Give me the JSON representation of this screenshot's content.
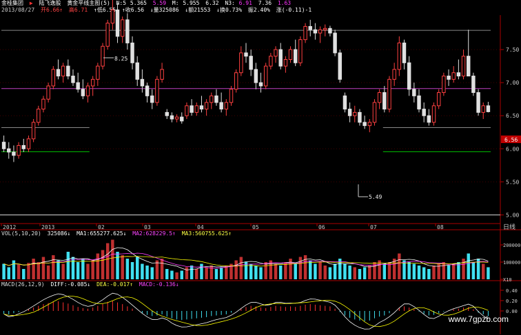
{
  "toolbar": {
    "stock": "金桂集团",
    "name": "陆飞逸股",
    "indicator": "黄金平线主图(5)",
    "n": "N:5",
    "v1": "5.365",
    "v2": "5.59",
    "m": "M:",
    "v3": "5.955",
    "v4": "6.32",
    "n3": "N3:",
    "v5": "6.91",
    "v6": "7.36",
    "v7": "1.63"
  },
  "quote": {
    "date": "2013/08/27",
    "open": "开6.66↑",
    "high": "高6.71",
    "low": "↑低6.55",
    "close": "↑收6.56",
    "vol": "↓量325086",
    "amount": "↓额21553",
    "turnover": "↓换0.73%",
    "amp": "振2.40%",
    "chg": "涨(-0.11)-1"
  },
  "chart_data": {
    "type": "candlestick",
    "colors": {
      "up": "#ff4040",
      "down": "#e0e0e0",
      "ma1": "#ffffff",
      "ma2": "#ff40ff",
      "ma3": "#ffff00",
      "hline": "#c040c0",
      "green": "#00c000"
    },
    "price_axis": {
      "min": 4.9,
      "max": 8.0,
      "ticks": [
        "5.00",
        "5.50",
        "6.00",
        "6.50",
        "7.00",
        "7.50"
      ]
    },
    "current_price": "6.56",
    "max_label": "8.25",
    "min_label": "5.49",
    "x_labels": [
      "2012",
      "2013",
      "02",
      "03",
      "04",
      "05",
      "06",
      "07",
      "08"
    ],
    "period_button": "日线",
    "candles": [
      [
        6.1,
        6.2,
        5.95,
        6.0
      ],
      [
        6.0,
        6.1,
        5.85,
        5.95
      ],
      [
        5.95,
        6.05,
        5.8,
        5.9
      ],
      [
        5.9,
        6.1,
        5.85,
        6.05
      ],
      [
        6.05,
        6.15,
        5.95,
        6.0
      ],
      [
        6.0,
        6.2,
        5.95,
        6.15
      ],
      [
        6.15,
        6.45,
        6.1,
        6.4
      ],
      [
        6.4,
        6.65,
        6.35,
        6.6
      ],
      [
        6.6,
        6.8,
        6.55,
        6.75
      ],
      [
        6.75,
        7.0,
        6.7,
        6.95
      ],
      [
        6.95,
        7.25,
        6.9,
        7.2
      ],
      [
        7.2,
        7.35,
        7.05,
        7.1
      ],
      [
        7.1,
        7.3,
        7.0,
        7.25
      ],
      [
        7.25,
        7.35,
        7.05,
        7.1
      ],
      [
        7.1,
        7.2,
        6.95,
        7.0
      ],
      [
        7.0,
        7.15,
        6.85,
        6.9
      ],
      [
        6.9,
        7.05,
        6.75,
        6.8
      ],
      [
        6.8,
        7.0,
        6.7,
        6.95
      ],
      [
        6.95,
        7.1,
        6.8,
        7.05
      ],
      [
        7.05,
        7.3,
        6.95,
        7.25
      ],
      [
        7.25,
        7.6,
        7.2,
        7.55
      ],
      [
        7.55,
        7.95,
        7.5,
        7.9
      ],
      [
        7.9,
        8.25,
        7.8,
        8.1
      ],
      [
        8.1,
        8.2,
        7.6,
        7.7
      ],
      [
        7.7,
        8.0,
        7.6,
        7.95
      ],
      [
        7.95,
        8.05,
        7.5,
        7.6
      ],
      [
        7.6,
        7.7,
        7.2,
        7.3
      ],
      [
        7.3,
        7.4,
        6.95,
        7.05
      ],
      [
        7.05,
        7.2,
        6.85,
        6.95
      ],
      [
        6.95,
        7.0,
        6.7,
        6.8
      ],
      [
        6.8,
        6.9,
        6.6,
        6.7
      ],
      [
        6.7,
        7.1,
        6.65,
        7.05
      ],
      [
        7.05,
        7.3,
        7.0,
        7.2
      ],
      [
        6.55,
        6.6,
        6.45,
        6.5
      ],
      [
        6.5,
        6.55,
        6.4,
        6.45
      ],
      [
        6.45,
        6.52,
        6.4,
        6.48
      ],
      [
        6.48,
        6.55,
        6.38,
        6.42
      ],
      [
        6.5,
        6.7,
        6.45,
        6.65
      ],
      [
        6.65,
        6.75,
        6.5,
        6.55
      ],
      [
        6.55,
        6.7,
        6.5,
        6.65
      ],
      [
        6.65,
        6.8,
        6.55,
        6.6
      ],
      [
        6.6,
        6.75,
        6.5,
        6.7
      ],
      [
        6.7,
        6.85,
        6.6,
        6.8
      ],
      [
        6.8,
        6.9,
        6.65,
        6.7
      ],
      [
        6.7,
        6.85,
        6.55,
        6.6
      ],
      [
        6.6,
        6.75,
        6.5,
        6.7
      ],
      [
        6.7,
        6.95,
        6.65,
        6.9
      ],
      [
        6.9,
        7.2,
        6.85,
        7.15
      ],
      [
        7.15,
        7.55,
        7.1,
        7.45
      ],
      [
        7.45,
        7.6,
        7.3,
        7.4
      ],
      [
        7.4,
        7.5,
        7.1,
        7.2
      ],
      [
        7.2,
        7.3,
        6.9,
        7.0
      ],
      [
        7.0,
        7.15,
        6.85,
        6.95
      ],
      [
        6.95,
        7.3,
        6.9,
        7.25
      ],
      [
        7.25,
        7.45,
        7.2,
        7.4
      ],
      [
        7.4,
        7.55,
        7.3,
        7.5
      ],
      [
        7.5,
        7.6,
        7.2,
        7.25
      ],
      [
        7.25,
        7.4,
        7.15,
        7.35
      ],
      [
        7.35,
        7.55,
        7.3,
        7.5
      ],
      [
        7.5,
        7.65,
        7.25,
        7.3
      ],
      [
        7.3,
        7.7,
        7.25,
        7.65
      ],
      [
        7.65,
        7.9,
        7.6,
        7.85
      ],
      [
        7.85,
        7.95,
        7.7,
        7.8
      ],
      [
        7.8,
        7.9,
        7.65,
        7.75
      ],
      [
        7.75,
        7.85,
        7.6,
        7.8
      ],
      [
        7.8,
        7.88,
        7.7,
        7.82
      ],
      [
        7.82,
        7.86,
        7.7,
        7.75
      ],
      [
        7.75,
        7.8,
        7.4,
        7.45
      ],
      [
        7.45,
        7.5,
        7.0,
        7.05
      ],
      [
        6.8,
        6.85,
        6.55,
        6.6
      ],
      [
        6.6,
        6.7,
        6.4,
        6.5
      ],
      [
        6.5,
        6.65,
        6.4,
        6.55
      ],
      [
        6.55,
        6.6,
        6.35,
        6.4
      ],
      [
        6.4,
        6.5,
        6.3,
        6.35
      ],
      [
        6.35,
        6.45,
        6.25,
        6.4
      ],
      [
        6.4,
        6.75,
        6.35,
        6.7
      ],
      [
        6.7,
        6.9,
        6.6,
        6.85
      ],
      [
        6.85,
        6.95,
        6.55,
        6.6
      ],
      [
        6.6,
        7.1,
        6.55,
        7.05
      ],
      [
        7.05,
        7.3,
        6.95,
        7.2
      ],
      [
        7.2,
        7.7,
        7.1,
        7.6
      ],
      [
        7.6,
        7.65,
        7.2,
        7.3
      ],
      [
        7.3,
        7.4,
        6.8,
        6.9
      ],
      [
        6.9,
        7.0,
        6.7,
        6.8
      ],
      [
        6.8,
        6.9,
        6.55,
        6.6
      ],
      [
        6.6,
        6.7,
        6.4,
        6.5
      ],
      [
        6.5,
        6.6,
        6.35,
        6.4
      ],
      [
        6.4,
        6.7,
        6.35,
        6.65
      ],
      [
        6.65,
        6.9,
        6.6,
        6.85
      ],
      [
        6.85,
        7.15,
        6.8,
        7.1
      ],
      [
        7.1,
        7.2,
        6.95,
        7.05
      ],
      [
        7.05,
        7.25,
        7.0,
        7.15
      ],
      [
        7.15,
        7.35,
        7.05,
        7.1
      ],
      [
        7.1,
        7.5,
        7.05,
        7.4
      ],
      [
        7.4,
        7.8,
        7.3,
        7.1
      ],
      [
        7.1,
        7.15,
        6.8,
        6.85
      ],
      [
        6.85,
        6.9,
        6.5,
        6.55
      ],
      [
        6.55,
        6.7,
        6.45,
        6.65
      ],
      [
        6.65,
        6.71,
        6.55,
        6.56
      ]
    ],
    "h_lines": [
      {
        "price": 7.79,
        "color": "#888888"
      },
      {
        "price": 6.91,
        "color": "#c040c0"
      },
      {
        "price": 5.955,
        "color": "#00c000",
        "segments": [
          [
            0,
            18
          ],
          [
            78,
            100
          ]
        ]
      },
      {
        "price": 6.32,
        "color": "#888888",
        "segments": [
          [
            0,
            18
          ],
          [
            78,
            100
          ]
        ]
      }
    ],
    "volume": {
      "label": "VOL(5,10,20)",
      "value": "325086↓",
      "ma1": "MA1:655277.625↓",
      "ma2": "MA2:628229.5↑",
      "ma3": "MA3:560755.625↑",
      "axis_ticks": [
        "200000",
        "100000",
        "X10"
      ],
      "max": 2400000,
      "values": [
        900000,
        700000,
        1100000,
        850000,
        600000,
        950000,
        1200000,
        1000000,
        1300000,
        800000,
        1400000,
        1100000,
        900000,
        1600000,
        1300000,
        1000000,
        1200000,
        900000,
        1100000,
        1500000,
        1700000,
        2100000,
        2300000,
        1600000,
        1400000,
        1200000,
        1000000,
        1300000,
        900000,
        800000,
        700000,
        1100000,
        1200000,
        600000,
        500000,
        400000,
        500000,
        700000,
        800000,
        600000,
        900000,
        700000,
        800000,
        600000,
        700000,
        800000,
        900000,
        1100000,
        1300000,
        1000000,
        900000,
        800000,
        700000,
        1000000,
        1100000,
        900000,
        800000,
        1000000,
        1200000,
        900000,
        1300000,
        1400000,
        1100000,
        900000,
        1000000,
        800000,
        700000,
        900000,
        1200000,
        900000,
        800000,
        700000,
        600000,
        700000,
        800000,
        1000000,
        1100000,
        900000,
        1000000,
        1200000,
        1500000,
        1100000,
        1000000,
        900000,
        800000,
        700000,
        600000,
        800000,
        900000,
        1000000,
        800000,
        900000,
        1000000,
        1200000,
        1500000,
        1000000,
        1200000,
        900000,
        700000
      ]
    },
    "macd": {
      "label": "MACD(26,12,9)",
      "diff": "DIFF:-0.085↓",
      "dea": "DEA:-0.017↑",
      "macd": "MACD:-0.136↓",
      "axis_ticks": [
        "0.40",
        "0.20",
        "0.00"
      ],
      "values": [
        -0.05,
        -0.06,
        -0.04,
        -0.02,
        0.0,
        0.03,
        0.06,
        0.09,
        0.12,
        0.14,
        0.16,
        0.17,
        0.15,
        0.13,
        0.1,
        0.07,
        0.05,
        0.04,
        0.06,
        0.09,
        0.12,
        0.16,
        0.18,
        0.15,
        0.12,
        0.08,
        0.04,
        0.0,
        -0.04,
        -0.07,
        -0.09,
        -0.08,
        -0.06,
        -0.1,
        -0.13,
        -0.15,
        -0.16,
        -0.15,
        -0.14,
        -0.13,
        -0.12,
        -0.11,
        -0.09,
        -0.08,
        -0.07,
        -0.06,
        -0.03,
        0.0,
        0.04,
        0.07,
        0.09,
        0.08,
        0.06,
        0.05,
        0.07,
        0.09,
        0.08,
        0.07,
        0.08,
        0.07,
        0.09,
        0.11,
        0.12,
        0.11,
        0.1,
        0.09,
        0.08,
        0.04,
        -0.02,
        -0.08,
        -0.12,
        -0.15,
        -0.17,
        -0.18,
        -0.17,
        -0.13,
        -0.1,
        -0.08,
        -0.04,
        0.0,
        0.05,
        0.08,
        0.06,
        0.03,
        -0.01,
        -0.05,
        -0.08,
        -0.07,
        -0.04,
        -0.01,
        0.01,
        0.03,
        0.04,
        0.06,
        0.07,
        0.03,
        -0.03,
        -0.06,
        -0.09
      ]
    }
  },
  "watermark": "www.7gpzb.com"
}
